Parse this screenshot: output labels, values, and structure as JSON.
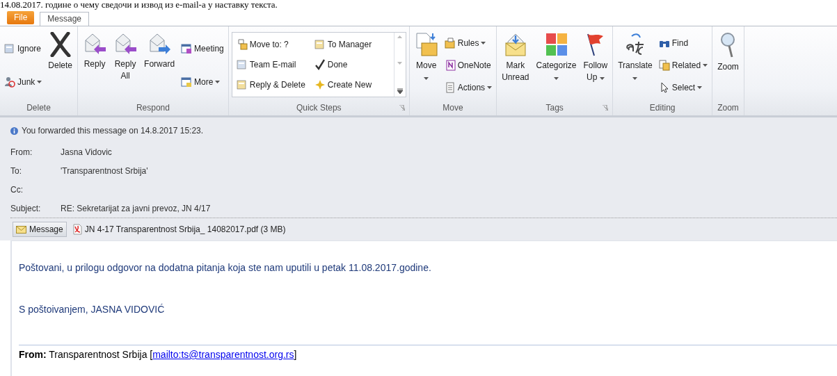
{
  "document_text": "14.08.2017. године о чему сведочи и извод из e-mail-a у наставку текста.",
  "tabs": [
    {
      "label": "File",
      "kind": "file",
      "selected": false
    },
    {
      "label": "Message",
      "kind": "tab",
      "selected": true
    }
  ],
  "ribbon": [
    {
      "label": "Delete",
      "launcher": false,
      "controls": [
        {
          "kind": "stack",
          "items": [
            {
              "label": "Ignore",
              "dropdown": false
            },
            {
              "label": "Junk",
              "dropdown": true
            }
          ]
        },
        {
          "kind": "large",
          "label": "Delete",
          "dropdown": false
        }
      ]
    },
    {
      "label": "Respond",
      "launcher": false,
      "controls": [
        {
          "kind": "large",
          "label": "Reply",
          "dropdown": false
        },
        {
          "kind": "large",
          "label": "Reply All",
          "dropdown": false
        },
        {
          "kind": "large",
          "label": "Forward",
          "dropdown": false
        },
        {
          "kind": "stack",
          "items": [
            {
              "label": "Meeting",
              "dropdown": false
            },
            {
              "label": "More",
              "dropdown": true
            }
          ]
        }
      ]
    },
    {
      "label": "Quick Steps",
      "launcher": true,
      "controls": [
        {
          "kind": "gallery",
          "items": [
            {
              "label": "Move to: ?"
            },
            {
              "label": "Team E-mail"
            },
            {
              "label": "Reply & Delete"
            },
            {
              "label": "To Manager"
            },
            {
              "label": "Done"
            },
            {
              "label": "Create New"
            }
          ]
        }
      ]
    },
    {
      "label": "Move",
      "launcher": false,
      "controls": [
        {
          "kind": "large",
          "label": "Move",
          "dropdown": true
        },
        {
          "kind": "stack",
          "items": [
            {
              "label": "Rules",
              "dropdown": true
            },
            {
              "label": "OneNote",
              "dropdown": false
            },
            {
              "label": "Actions",
              "dropdown": true
            }
          ]
        }
      ]
    },
    {
      "label": "Tags",
      "launcher": true,
      "controls": [
        {
          "kind": "large",
          "label": "Mark Unread",
          "dropdown": false
        },
        {
          "kind": "large",
          "label": "Categorize",
          "dropdown": true
        },
        {
          "kind": "large",
          "label": "Follow Up",
          "dropdown": true
        }
      ]
    },
    {
      "label": "Editing",
      "launcher": false,
      "controls": [
        {
          "kind": "large",
          "label": "Translate",
          "dropdown": true
        },
        {
          "kind": "stack",
          "items": [
            {
              "label": "Find",
              "dropdown": false
            },
            {
              "label": "Related",
              "dropdown": true
            },
            {
              "label": "Select",
              "dropdown": true
            }
          ]
        }
      ]
    },
    {
      "label": "Zoom",
      "launcher": false,
      "controls": [
        {
          "kind": "large",
          "label": "Zoom",
          "dropdown": false
        }
      ]
    }
  ],
  "info_bar": "You forwarded this message on 14.8.2017 15:23.",
  "header_fields": [
    {
      "label": "From:",
      "value": "Jasna Vidovic"
    },
    {
      "label": "To:",
      "value": "'Transparentnost Srbija'"
    },
    {
      "label": "Cc:"
    },
    {
      "label": "Subject:",
      "value": "RE: Sekretarijat za javni prevoz, JN 4/17"
    }
  ],
  "attachments": [
    {
      "kind": "message",
      "label": "Message",
      "selected": true
    },
    {
      "kind": "pdf",
      "label": "JN 4-17 Transparentnost Srbija_ 14082017.pdf (3 MB)",
      "selected": false
    }
  ],
  "body": [
    "Poštovani, u prilogu odgovor na dodatna pitanja koja ste nam uputili u petak 11.08.2017.godine.",
    "S poštoivanjem, JASNA VIDOVIĆ"
  ],
  "quoted_header": {
    "before": "**From:** Transparentnost Srbija [",
    "link": "mailto:ts@transparentnost.org.rs",
    "after": "]"
  }
}
